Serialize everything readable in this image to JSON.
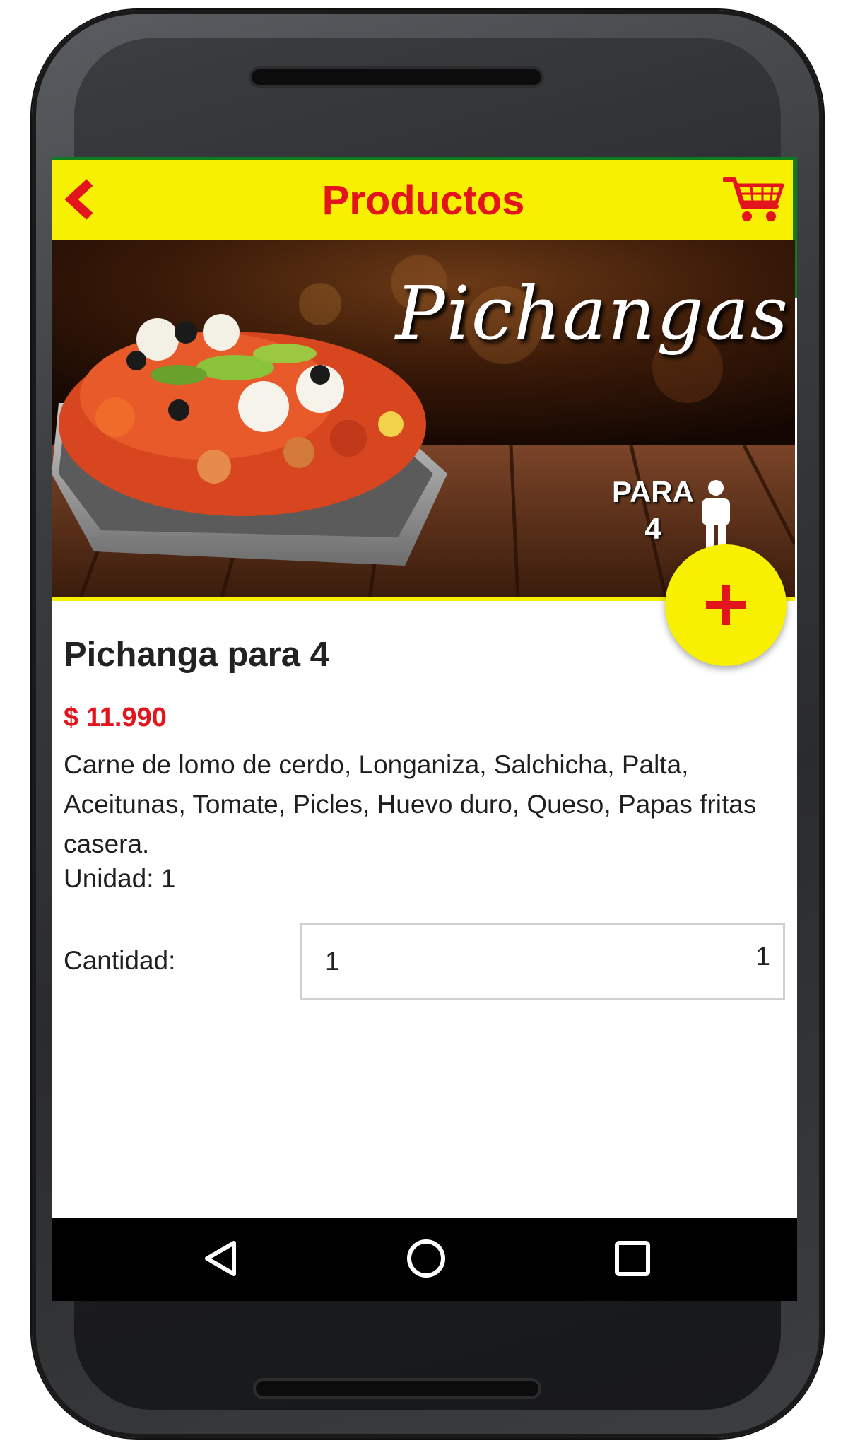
{
  "appbar": {
    "title": "Productos",
    "back_icon": "chevron-left-icon",
    "cart_icon": "cart-icon"
  },
  "banner": {
    "headline": "Pichangas",
    "para_label": "PARA",
    "para_count": "4"
  },
  "fab": {
    "icon": "plus-icon"
  },
  "product": {
    "name": "Pichanga para 4",
    "price": "$ 11.990",
    "description": "Carne de lomo de cerdo, Longaniza, Salchicha, Palta, Aceitunas, Tomate, Picles, Huevo duro, Queso, Papas fritas casera.",
    "unit_label": "Unidad:",
    "unit_value": "1"
  },
  "quantity": {
    "label": "Cantidad:",
    "value": "1",
    "right_value": "1"
  },
  "navbar": {
    "back_icon": "nav-back-icon",
    "home_icon": "nav-home-icon",
    "recents_icon": "nav-recents-icon"
  },
  "colors": {
    "accent_yellow": "#f7f000",
    "accent_red": "#e3141b",
    "status_green": "#0f7a1e"
  }
}
